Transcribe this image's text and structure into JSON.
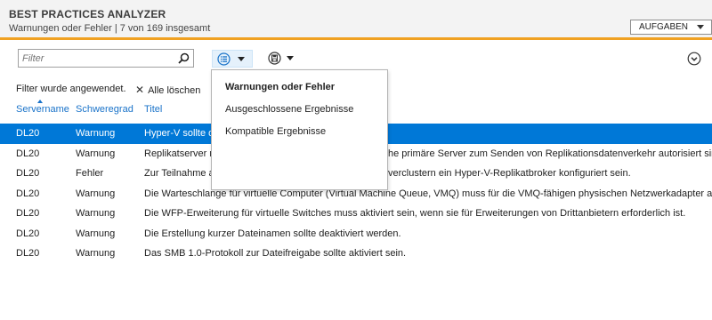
{
  "header": {
    "title": "BEST PRACTICES ANALYZER",
    "subtitle": "Warnungen oder Fehler | 7 von 169 insgesamt",
    "tasks_label": "AUFGABEN"
  },
  "toolbar": {
    "filter_placeholder": "Filter"
  },
  "filter_status": {
    "text": "Filter wurde angewendet.",
    "clear_all": "Alle löschen"
  },
  "columns": [
    "Servername",
    "Schweregrad",
    "Titel"
  ],
  "rows": [
    {
      "server": "DL20",
      "severity": "Warnung",
      "title": "Hyper-V sollte d",
      "selected": true
    },
    {
      "server": "DL20",
      "severity": "Warnung",
      "title": "Replikatserver m",
      "tail": "he primäre Server zum Senden von Replikationsdatenverkehr autorisiert sind"
    },
    {
      "server": "DL20",
      "severity": "Fehler",
      "title": "Zur Teilnahme a",
      "tail": "verclustern ein Hyper-V-Replikatbroker konfiguriert sein."
    },
    {
      "server": "DL20",
      "severity": "Warnung",
      "title": "Die Warteschlange für virtuelle Computer (Virtual Machine Queue, VMQ) muss für die VMQ-fähigen physischen Netzwerkadapter akt"
    },
    {
      "server": "DL20",
      "severity": "Warnung",
      "title": "Die WFP-Erweiterung für virtuelle Switches muss aktiviert sein, wenn sie für Erweiterungen von Drittanbietern erforderlich ist."
    },
    {
      "server": "DL20",
      "severity": "Warnung",
      "title": "Die Erstellung kurzer Dateinamen sollte deaktiviert werden."
    },
    {
      "server": "DL20",
      "severity": "Warnung",
      "title": "Das SMB 1.0-Protokoll zur Dateifreigabe sollte aktiviert sein."
    }
  ],
  "popup": {
    "items": [
      {
        "label": "Warnungen oder Fehler",
        "active": true
      },
      {
        "label": "Ausgeschlossene Ergebnisse"
      },
      {
        "label": "Kompatible Ergebnisse"
      }
    ]
  },
  "colors": {
    "accent_orange": "#f0a122",
    "selection_blue": "#0078d7",
    "link_blue": "#1a73c9"
  },
  "icons": [
    "search-icon",
    "list-view-icon",
    "save-icon",
    "chevron-down-circle-icon",
    "close-icon"
  ]
}
